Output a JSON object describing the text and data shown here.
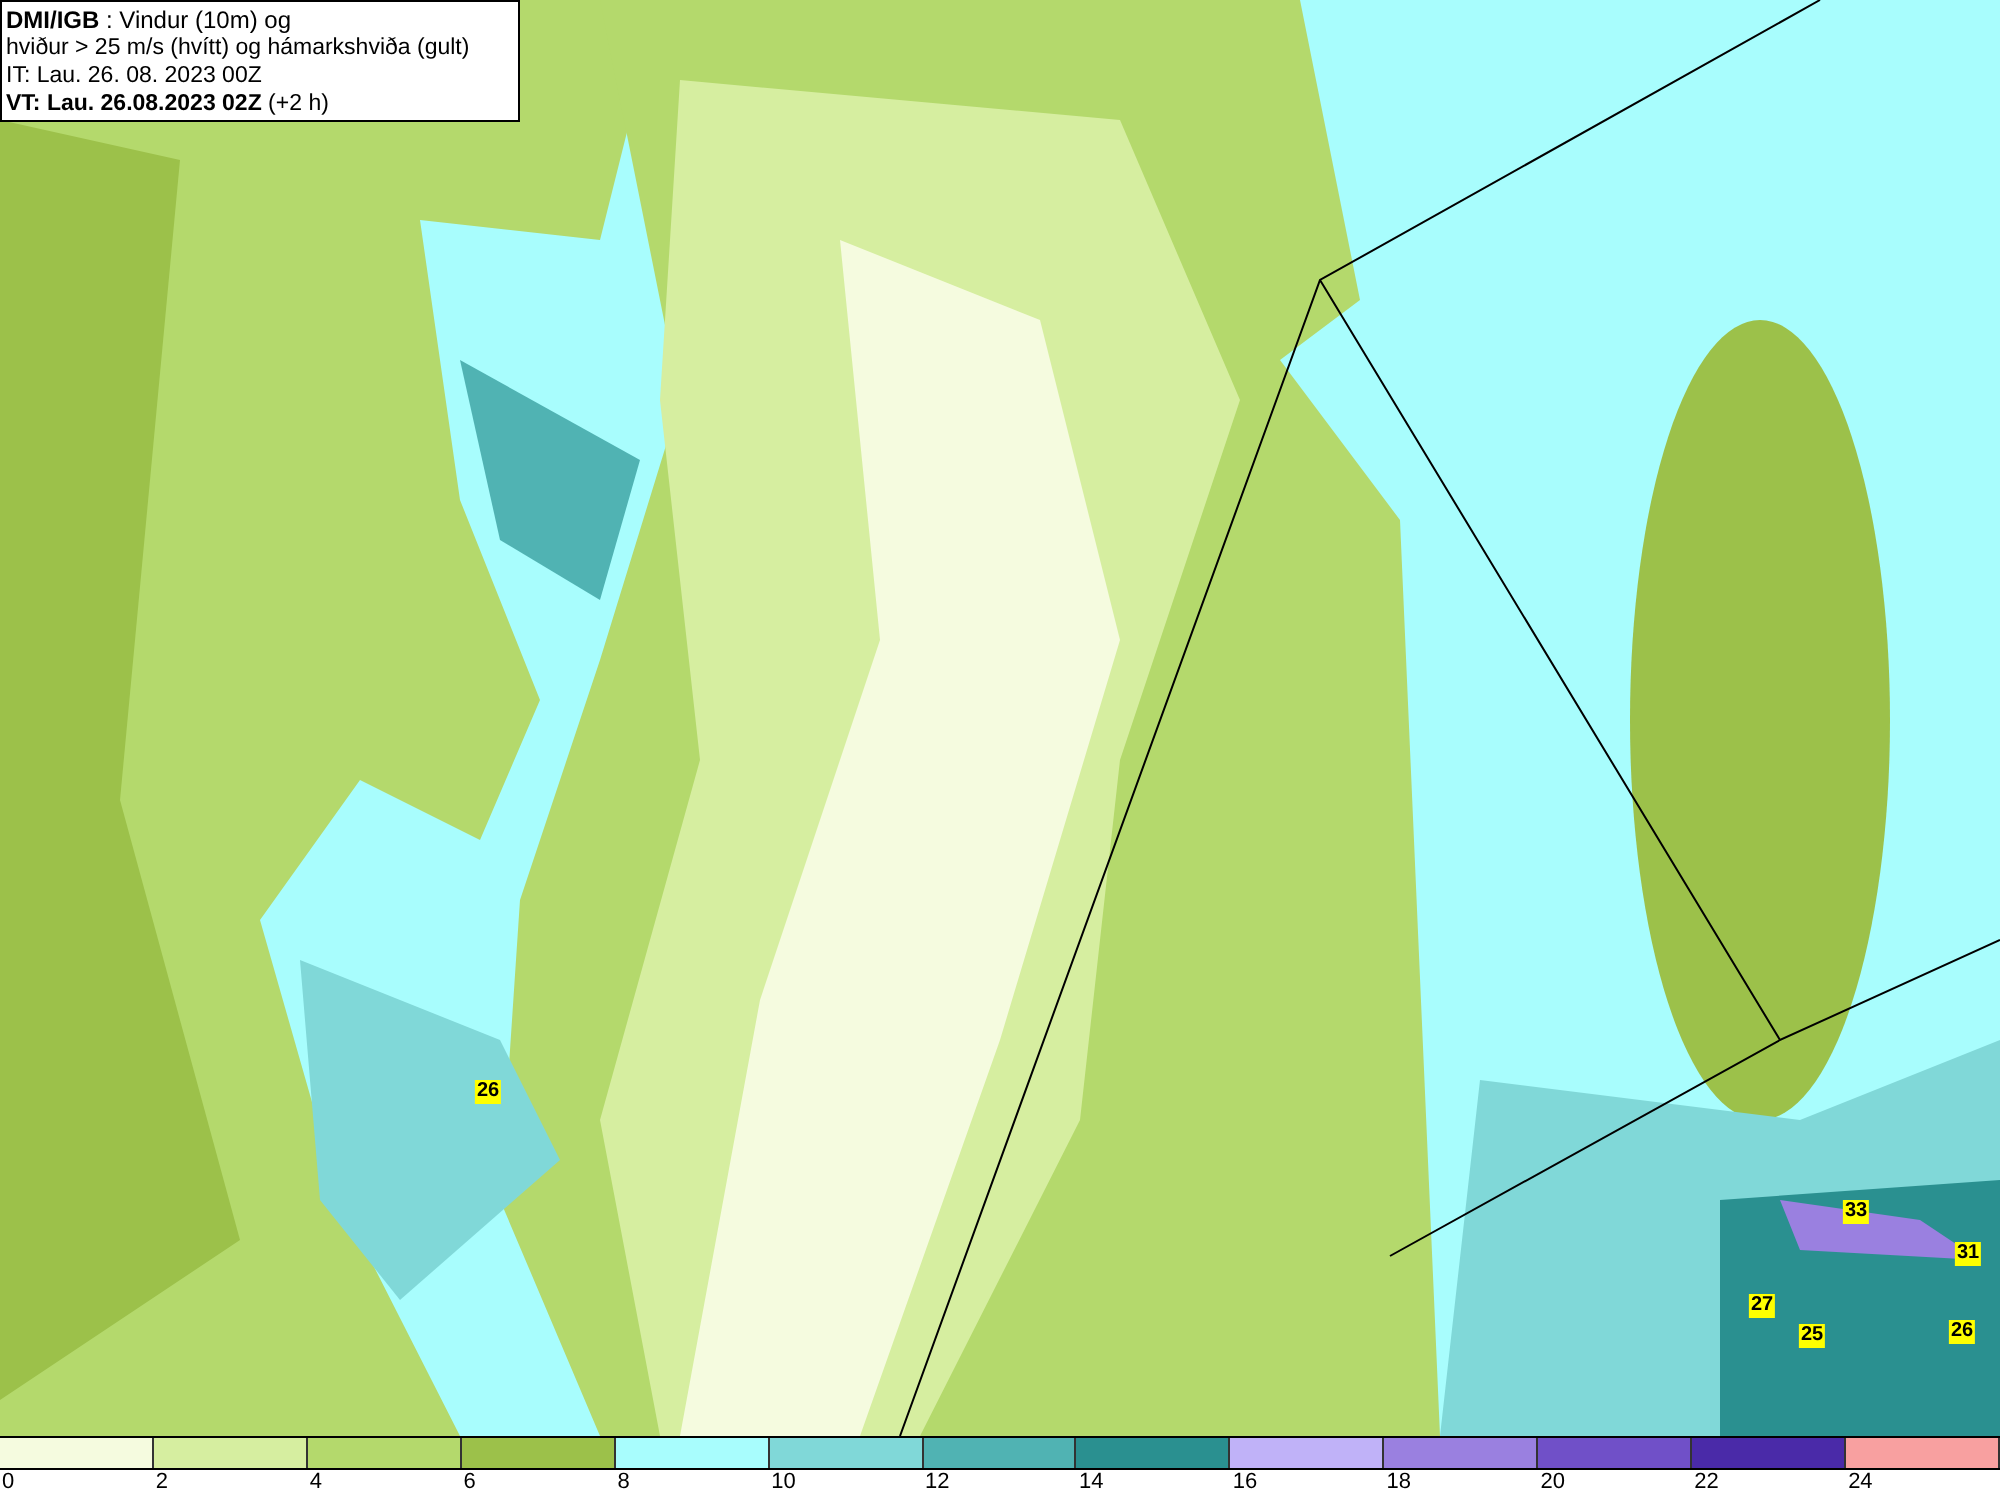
{
  "header": {
    "lines": [
      "**DMI/IGB** : Vindur (10m) og",
      "hviður > 25 m/s (hvítt) og hámarkshviða (gult)",
      "IT: Lau. 26. 08. 2023 00Z",
      "**VT: Lau. 26.08.2023 02Z** (+2 h)"
    ]
  },
  "gust_labels": [
    "26",
    "33",
    "31",
    "27",
    "25",
    "26"
  ],
  "legend": {
    "swatches": [
      {
        "color": "#f5fbdf"
      },
      {
        "color": "#d6eea0"
      },
      {
        "color": "#b4d96c"
      },
      {
        "color": "#9cc14a"
      },
      {
        "color": "#a8fdfd"
      },
      {
        "color": "#80d8d8"
      },
      {
        "color": "#50b3b3"
      },
      {
        "color": "#2a9090"
      },
      {
        "color": "#c0b2f8"
      },
      {
        "color": "#9a80e0"
      },
      {
        "color": "#7050c8"
      },
      {
        "color": "#4a2aa8"
      },
      {
        "color": "#f8a0a0"
      }
    ],
    "ticks": [
      "0",
      "2",
      "4",
      "6",
      "8",
      "10",
      "12",
      "14",
      "16",
      "18",
      "20",
      "22",
      "24"
    ]
  }
}
